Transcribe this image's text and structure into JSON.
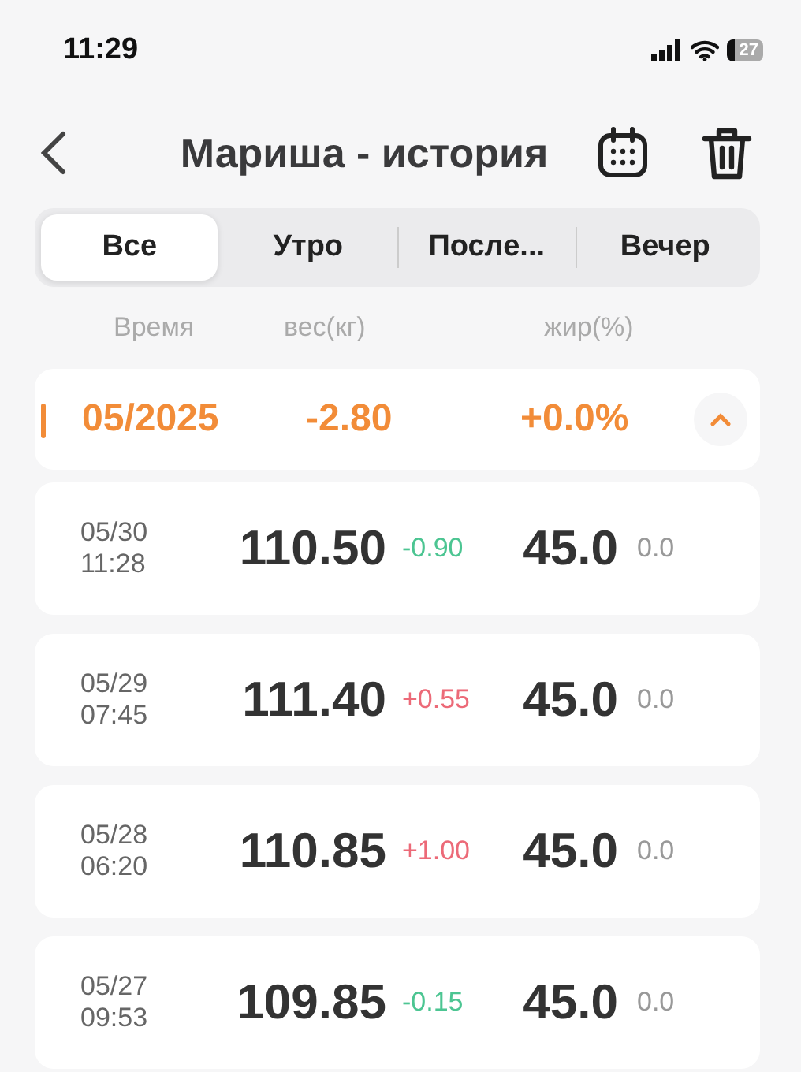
{
  "status_bar": {
    "time": "11:29",
    "battery": "27"
  },
  "header": {
    "title": "Мариша - история"
  },
  "tabs": [
    {
      "label": "Все",
      "selected": true
    },
    {
      "label": "Утро",
      "selected": false
    },
    {
      "label": "После...",
      "selected": false
    },
    {
      "label": "Вечер",
      "selected": false
    }
  ],
  "columns": [
    "Время",
    "вес(кг)",
    "жир(%)"
  ],
  "month": {
    "label": "05/2025",
    "weight_change": "-2.80",
    "fat_change": "+0.0%",
    "expanded": true
  },
  "records": [
    {
      "date": "05/30",
      "time": "11:28",
      "weight": "110.50",
      "delta": "-0.90",
      "color": "#4cc592",
      "fat": "45.0",
      "fat_delta": "0.0"
    },
    {
      "date": "05/29",
      "time": "07:45",
      "weight": "111.40",
      "delta": "+0.55",
      "color": "#ec6a78",
      "fat": "45.0",
      "fat_delta": "0.0"
    },
    {
      "date": "05/28",
      "time": "06:20",
      "weight": "110.85",
      "delta": "+1.00",
      "color": "#ec6a78",
      "fat": "45.0",
      "fat_delta": "0.0"
    },
    {
      "date": "05/27",
      "time": "09:53",
      "weight": "109.85",
      "delta": "-0.15",
      "color": "#4cc592",
      "fat": "45.0",
      "fat_delta": "0.0"
    }
  ]
}
